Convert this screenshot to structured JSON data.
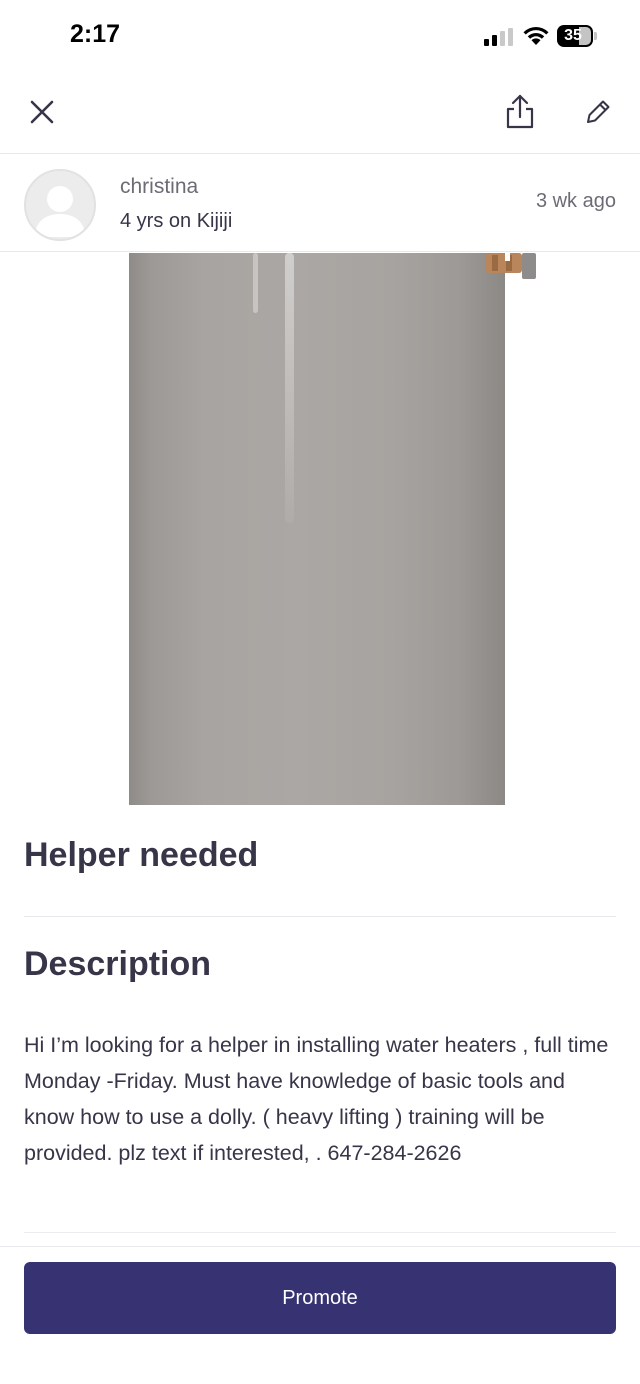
{
  "status_bar": {
    "time": "2:17",
    "battery": "35"
  },
  "nav": {
    "close_icon": "close-icon",
    "share_icon": "share-icon",
    "edit_icon": "pencil-icon"
  },
  "seller": {
    "name": "christina",
    "tenure": "4 yrs on Kijiji",
    "posted": "3 wk  ago"
  },
  "listing": {
    "title": "Helper needed",
    "description_heading": "Description",
    "description": "Hi I’m looking for a helper in installing water heaters , full time Monday -Friday. Must have knowledge of basic tools and know how to use a dolly. ( heavy lifting ) training will be provided. plz text if interested, . 647-284-2626"
  },
  "actions": {
    "promote_label": "Promote"
  },
  "colors": {
    "brand_primary": "#373373",
    "text_dark": "#373548",
    "text_muted": "#6c6c76"
  }
}
